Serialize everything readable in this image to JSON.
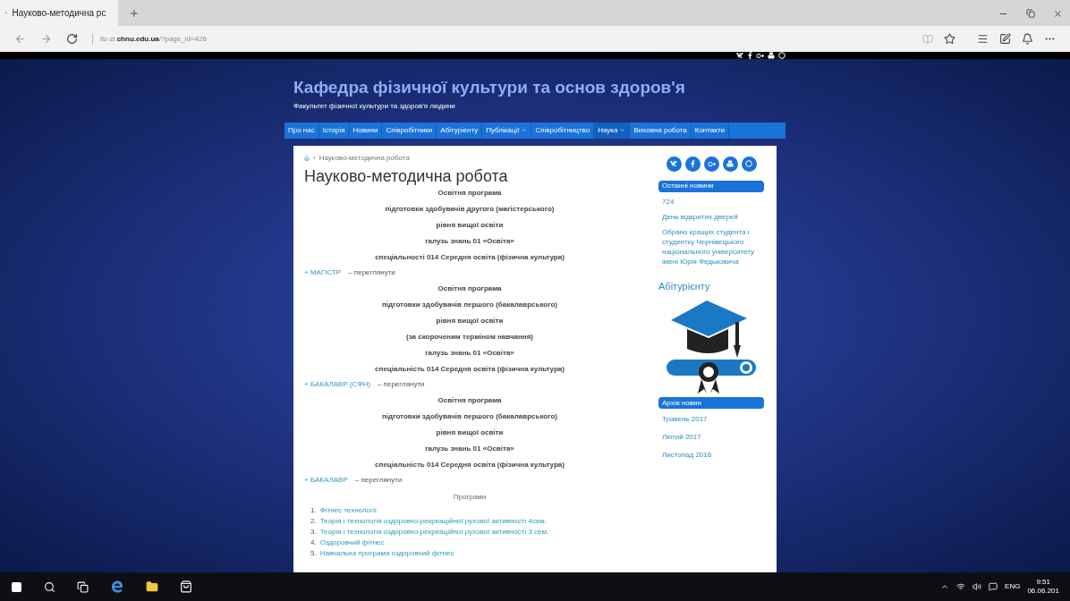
{
  "browser": {
    "tab": {
      "title": "Науково-методична рс"
    },
    "address": {
      "prefix": "fiz-zl.",
      "domain": "chnu.edu.ua",
      "path": "/?page_id=426"
    }
  },
  "site": {
    "title": "Кафедра фізичної культури та основ здоров'я",
    "subtitle": "Факультет фізичної культури та здоров'я людини",
    "nav": [
      {
        "label": "Про нас",
        "selected": false,
        "dropdown": false
      },
      {
        "label": "Історія",
        "selected": false,
        "dropdown": false
      },
      {
        "label": "Новини",
        "selected": false,
        "dropdown": false
      },
      {
        "label": "Співробітники",
        "selected": false,
        "dropdown": false
      },
      {
        "label": "Абітурієнту",
        "selected": false,
        "dropdown": false
      },
      {
        "label": "Публікації",
        "selected": false,
        "dropdown": true
      },
      {
        "label": "Співробітництво",
        "selected": false,
        "dropdown": false
      },
      {
        "label": "Наука",
        "selected": true,
        "dropdown": true
      },
      {
        "label": "Виховна робота",
        "selected": false,
        "dropdown": false
      },
      {
        "label": "Контакти",
        "selected": false,
        "dropdown": false
      }
    ]
  },
  "breadcrumb": {
    "separator": "›",
    "label": "Науково-методична робота"
  },
  "page_title": "Науково-методична робота",
  "blocks": [
    {
      "kind": "centered",
      "lines": [
        "Освітня програма",
        "підготовки здобувачів другого (магістерського)",
        "рівня вищої освіти",
        "галузь знань 01 «Освіта»",
        "спеціальності 014 Середня освіта (фізична культура)"
      ]
    },
    {
      "kind": "link",
      "link": "+ МАГІСТР",
      "rest": "– переглянути"
    },
    {
      "kind": "centered",
      "lines": [
        "Освітня програма",
        "підготовки здобувачів першого (бакалаврського)",
        "рівня вищої освіти",
        "(за скороченим терміном навчання)",
        "галузь знань 01 «Освіта»",
        "спеціальність 014 Середня освіта (фізична культура)"
      ]
    },
    {
      "kind": "link",
      "link": "+ БАКАЛАВР (СФН)",
      "rest": "– переглянути"
    },
    {
      "kind": "centered",
      "lines": [
        "Освітня програма",
        "підготовки здобувачів першого (бакалаврського)",
        "рівня вищої освіти",
        "галузь знань 01 «Освіта»",
        "спеціальність 014 Середня освіта (фізична культура)"
      ]
    },
    {
      "kind": "link",
      "link": "+ БАКАЛАВР",
      "rest": "– переглянути"
    }
  ],
  "programs": {
    "heading": "Програми",
    "items": [
      {
        "number": "1.",
        "label": "Фітнес технології"
      },
      {
        "number": "2.",
        "label": "Теорія і технологія оздоровчо-рекреаційної рухової активності 4сем."
      },
      {
        "number": "3.",
        "label": "Теорія і технологія оздоровчо-рекреаційної рухової активності 3 сем."
      },
      {
        "number": "4.",
        "label": "Оздоровчий фітнес"
      },
      {
        "number": "5.",
        "label": "Навчальна програма оздоровчий фітнес"
      }
    ]
  },
  "sidebar": {
    "latest": {
      "title": "Останні новини",
      "items": [
        "724",
        "День відкритих дверей",
        "Обрано кращих студента і студентку Чернівецького національного університету імені Юрія Федьковича"
      ]
    },
    "applicant": {
      "title": "Абітурієнту"
    },
    "archive": {
      "title": "Архів новин",
      "items": [
        "Травень 2017",
        "Лютий 2017",
        "Листопад 2016"
      ]
    }
  },
  "taskbar": {
    "language": "ENG",
    "time": "9:51",
    "date": "06.06.201"
  }
}
